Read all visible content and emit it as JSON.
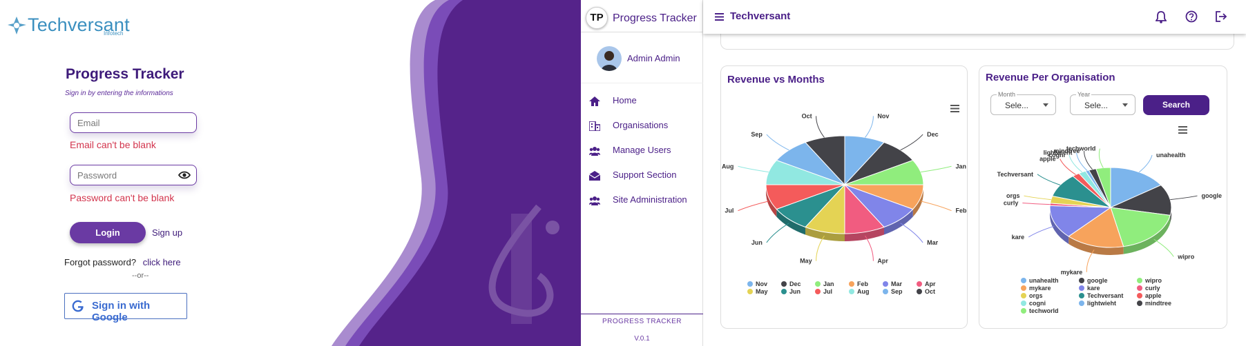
{
  "login": {
    "logo": {
      "name": "Techversant",
      "sub": "Infotech"
    },
    "title": "Progress Tracker",
    "subtitle": "Sign in by entering the informations",
    "email": {
      "placeholder": "Email",
      "error": "Email can't be blank"
    },
    "password": {
      "placeholder": "Password",
      "error": "Password can't be blank"
    },
    "login_label": "Login",
    "signup_label": "Sign up",
    "forgot_text": "Forgot password?",
    "forgot_link": "click here",
    "or_text": "--or--",
    "google_label": "Sign in with Google",
    "colors": {
      "brand_purple": "#55238a",
      "accent": "#6a3aa3",
      "error": "#d2344d"
    }
  },
  "sidebar": {
    "logo_glyph": "TP",
    "title": "Progress Tracker",
    "user_name": "Admin Admin",
    "items": [
      {
        "label": "Home",
        "icon": "home-icon"
      },
      {
        "label": "Organisations",
        "icon": "building-icon"
      },
      {
        "label": "Manage Users",
        "icon": "users-icon"
      },
      {
        "label": "Support Section",
        "icon": "mail-open-icon"
      },
      {
        "label": "Site Administration",
        "icon": "users-icon"
      }
    ],
    "footer_title": "PROGRESS TRACKER",
    "footer_version": "V.0.1"
  },
  "header": {
    "title": "Techversant",
    "icons": [
      "bell-icon",
      "help-icon",
      "logout-icon"
    ]
  },
  "revenue_months": {
    "title": "Revenue vs Months",
    "menu_icon": "hamburger-icon"
  },
  "revenue_org": {
    "title": "Revenue Per Organisation",
    "month": {
      "label": "Month",
      "value": "Sele..."
    },
    "year": {
      "label": "Year",
      "value": "Sele..."
    },
    "search_label": "Search",
    "menu_icon": "hamburger-icon"
  },
  "chart_data": [
    {
      "type": "pie",
      "title": "Revenue vs Months",
      "categories": [
        "Nov",
        "Dec",
        "Jan",
        "Feb",
        "Mar",
        "Apr",
        "May",
        "Jun",
        "Jul",
        "Aug",
        "Sep",
        "Oct"
      ],
      "values": [
        1,
        1,
        1,
        1,
        1,
        1,
        1,
        1,
        1,
        1,
        1,
        1
      ],
      "colors": [
        "#7cb5ec",
        "#434348",
        "#90ed7d",
        "#f7a35c",
        "#8085e9",
        "#f15c80",
        "#e4d354",
        "#2b908f",
        "#f45b5b",
        "#91e8e1",
        "#7cb5ec",
        "#434348"
      ],
      "legend_position": "bottom"
    },
    {
      "type": "pie",
      "title": "Revenue Per Organisation",
      "categories": [
        "unahealth",
        "google",
        "wipro",
        "mykare",
        "kare",
        "curly",
        "orgs",
        "Techversant",
        "apple",
        "cogni",
        "lightwieht",
        "mindtree",
        "techworld"
      ],
      "values": [
        16,
        13,
        19,
        16,
        14,
        1,
        3,
        10,
        2,
        2,
        1,
        2,
        4
      ],
      "colors": [
        "#7cb5ec",
        "#434348",
        "#90ed7d",
        "#f7a35c",
        "#8085e9",
        "#f15c80",
        "#e4d354",
        "#2b908f",
        "#f45b5b",
        "#91e8e1",
        "#7cb5ec",
        "#434348",
        "#90ed7d"
      ],
      "legend_position": "bottom"
    }
  ]
}
